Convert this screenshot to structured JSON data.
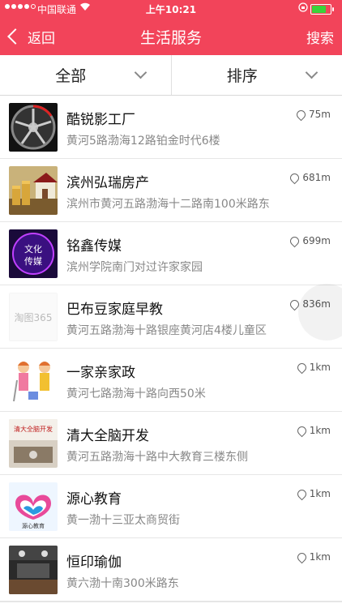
{
  "status_bar": {
    "carrier": "中国联通",
    "time": "上午10:21"
  },
  "nav": {
    "back_label": "返回",
    "title": "生活服务",
    "search_label": "搜索"
  },
  "filters": {
    "all_label": "全部",
    "sort_label": "排序"
  },
  "list": [
    {
      "name": "酷锐影工厂",
      "address": "黄河5路渤海12路铂金时代6楼",
      "distance": "75m",
      "thumb": "wheel-photo"
    },
    {
      "name": "滨州弘瑞房产",
      "address": "滨州市黄河五路渤海十二路南100米路东",
      "distance": "681m",
      "thumb": "house-coins-photo"
    },
    {
      "name": "铭鑫传媒",
      "address": "滨州学院南门对过许家家园",
      "distance": "699m",
      "thumb": "culture-media-logo",
      "thumb_text": "文化传媒"
    },
    {
      "name": "巴布豆家庭早教",
      "address": "黄河五路渤海十路银座黄河店4楼儿童区",
      "distance": "836m",
      "thumb": "taotu365-logo",
      "thumb_text": "淘图365"
    },
    {
      "name": "一家亲家政",
      "address": "黄河七路渤海十路向西50米",
      "distance": "1km",
      "thumb": "cleaners-illustration"
    },
    {
      "name": "清大全脑开发",
      "address": "黄河五路渤海十路中大教育三楼东侧",
      "distance": "1km",
      "thumb": "classroom-photo",
      "thumb_text": "清大全脑开发"
    },
    {
      "name": "源心教育",
      "address": "黄一渤十三亚太商贸街",
      "distance": "1km",
      "thumb": "hearts-logo",
      "thumb_text": "源心教育"
    },
    {
      "name": "恒印瑜伽",
      "address": "黄六渤十南300米路东",
      "distance": "1km",
      "thumb": "yoga-room-photo"
    }
  ]
}
